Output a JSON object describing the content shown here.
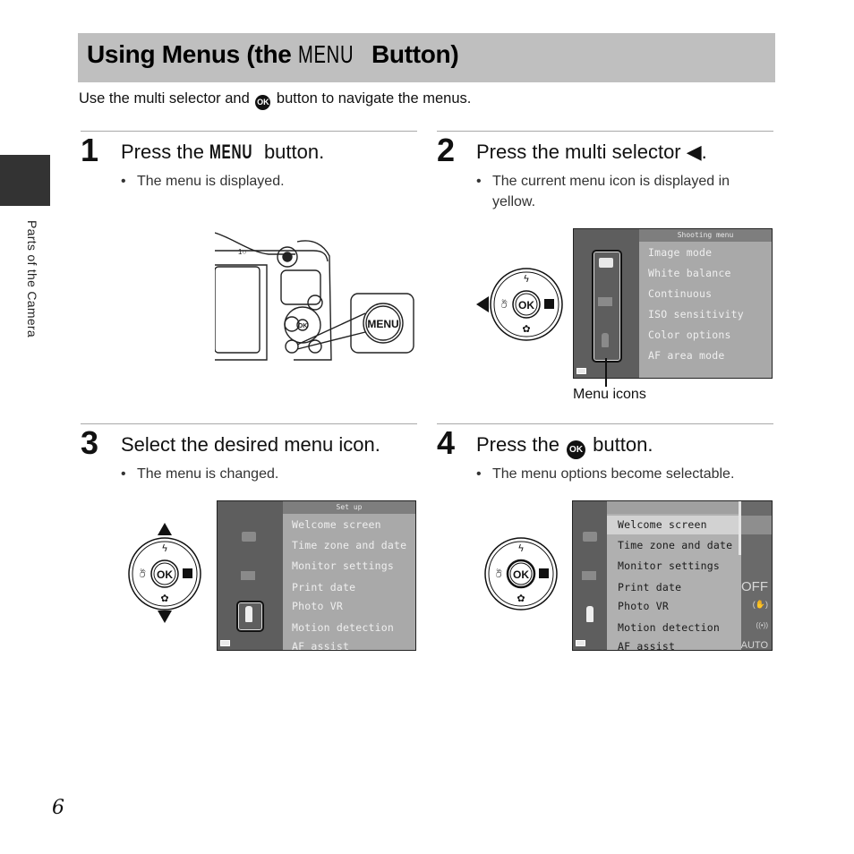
{
  "page": {
    "title_prefix": "Using Menus (the ",
    "title_menu_word": "MENU",
    "title_suffix": " Button)",
    "intro_before": "Use the multi selector and ",
    "intro_ok": "OK",
    "intro_after": " button to navigate the menus.",
    "side_tab_label": "Parts of the Camera",
    "page_number": "6"
  },
  "steps": [
    {
      "number": "1",
      "heading_before": "Press the ",
      "heading_key": "MENU",
      "heading_after": " button.",
      "bullets": [
        "The menu is displayed."
      ],
      "figure": {
        "callout_label": "MENU"
      }
    },
    {
      "number": "2",
      "heading_before": "Press the multi selector ",
      "heading_key": "◀",
      "heading_after": ".",
      "bullets": [
        "The current menu icon is displayed in yellow."
      ],
      "figure": {
        "screen_header": "Shooting menu",
        "items": [
          "Image mode",
          "White balance",
          "Continuous",
          "ISO sensitivity",
          "Color options",
          "AF area mode"
        ],
        "callout_label": "Menu icons",
        "selector_ok": "OK"
      }
    },
    {
      "number": "3",
      "heading_before": "Select the desired menu icon.",
      "heading_key": "",
      "heading_after": "",
      "bullets": [
        "The menu is changed."
      ],
      "figure": {
        "screen_header": "Set up",
        "items": [
          "Welcome screen",
          "Time zone and date",
          "Monitor settings",
          "Print date",
          "Photo VR",
          "Motion detection",
          "AF assist"
        ],
        "selector_ok": "OK"
      }
    },
    {
      "number": "4",
      "heading_before": "Press the ",
      "heading_key": "OK",
      "heading_after": " button.",
      "bullets": [
        "The menu options become selectable."
      ],
      "figure": {
        "items": [
          "Welcome screen",
          "Time zone and date",
          "Monitor settings",
          "Print date",
          "Photo VR",
          "Motion detection",
          "AF assist"
        ],
        "values": [
          "OFF",
          "(✋)",
          "((•))",
          "AUTO"
        ],
        "selector_ok": "OK"
      }
    }
  ]
}
